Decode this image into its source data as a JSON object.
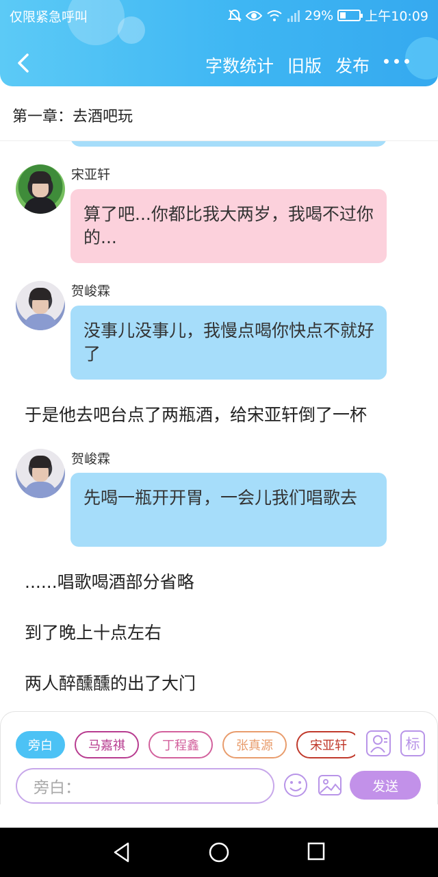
{
  "status_bar": {
    "carrier_text": "仅限紧急呼叫",
    "battery": "29%",
    "battery_level": 0.29,
    "time": "上午10:09"
  },
  "nav": {
    "actions": [
      "字数统计",
      "旧版",
      "发布"
    ]
  },
  "chapter": {
    "title": "第一章：去酒吧玩"
  },
  "messages": [
    {
      "type": "dialogue",
      "speaker": "宋亚轩",
      "text": "算了吧...你都比我大两岁，我喝不过你的...",
      "color": "#fcd1dc"
    },
    {
      "type": "dialogue",
      "speaker": "贺峻霖",
      "text": "没事儿没事儿，我慢点喝你快点不就好了",
      "color": "#a6ddfa"
    },
    {
      "type": "narration",
      "text": "于是他去吧台点了两瓶酒，给宋亚轩倒了一杯"
    },
    {
      "type": "dialogue",
      "speaker": "贺峻霖",
      "text": "先喝一瓶开开胃，一会儿我们唱歌去",
      "color": "#a6ddfa"
    },
    {
      "type": "narration",
      "text": "......唱歌喝酒部分省略"
    },
    {
      "type": "narration",
      "text": "到了晚上十点左右"
    },
    {
      "type": "narration",
      "text": "两人醉醺醺的出了大门"
    }
  ],
  "roles": [
    {
      "label": "旁白",
      "active": true,
      "color": "#4cc2f5"
    },
    {
      "label": "马嘉祺",
      "active": false,
      "color": "#b73b8f"
    },
    {
      "label": "丁程鑫",
      "active": false,
      "color": "#d2609c"
    },
    {
      "label": "张真源",
      "active": false,
      "color": "#e89c6c"
    },
    {
      "label": "宋亚轩",
      "active": false,
      "color": "#c0392b"
    }
  ],
  "tools": {
    "mark_label": "标"
  },
  "input": {
    "placeholder": "旁白："
  },
  "send_label": "发送",
  "icons": [
    "back-arrow-icon",
    "more-dots-icon",
    "mute-icon",
    "eye-icon",
    "wifi-icon",
    "signal-icon",
    "battery-icon",
    "role-person-icon",
    "emoji-icon",
    "image-icon",
    "nav-back-icon",
    "nav-home-icon",
    "nav-recents-icon"
  ]
}
